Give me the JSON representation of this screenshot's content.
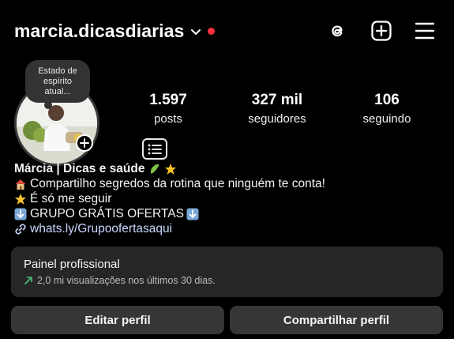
{
  "header": {
    "username": "marcia.dicasdiarias",
    "colors": {
      "notification_dot": "#ff3040"
    },
    "icons": [
      "chevron-down-icon",
      "threads-icon",
      "new-post-icon",
      "menu-icon"
    ]
  },
  "profile": {
    "note": "Estado de espírito atual...",
    "stats": [
      {
        "value": "1.597",
        "label": "posts"
      },
      {
        "value": "327 mil",
        "label": "seguidores"
      },
      {
        "value": "106",
        "label": "seguindo"
      }
    ]
  },
  "bio": {
    "name": "Márcia | Dicas e saúde",
    "line1": "Compartilho segredos da rotina que ninguém te conta!",
    "line2": "É só me seguir",
    "line3": "GRUPO GRÁTIS OFERTAS",
    "link": "whats.ly/Grupoofertasaqui"
  },
  "panel": {
    "title": "Painel profissional",
    "subtitle": "2,0 mi visualizações nos últimos 30 dias.",
    "accent_color": "#49c07a"
  },
  "actions": {
    "edit_label": "Editar perfil",
    "share_label": "Compartilhar perfil"
  }
}
